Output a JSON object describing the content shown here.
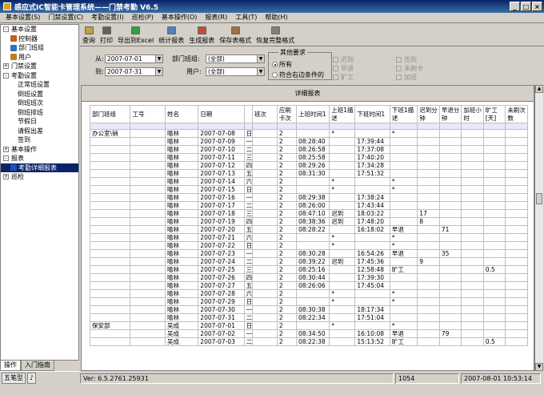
{
  "window": {
    "title": "感应式IC智能卡管理系统——门禁考勤 V6.5"
  },
  "menu": [
    "基本设置(S)",
    "门禁设置(C)",
    "考勤设置(I)",
    "巡检(P)",
    "基本操作(O)",
    "报表(R)",
    "工具(T)",
    "帮助(H)"
  ],
  "tree": [
    {
      "label": "基本设置",
      "level": 0,
      "exp": "-"
    },
    {
      "label": "控制器",
      "level": 1,
      "icon": "#c06020"
    },
    {
      "label": "部门班组",
      "level": 1,
      "icon": "#3070c0"
    },
    {
      "label": "用户",
      "level": 1,
      "icon": "#c08020"
    },
    {
      "label": "门禁设置",
      "level": 0,
      "exp": "+"
    },
    {
      "label": "考勤设置",
      "level": 0,
      "exp": "-"
    },
    {
      "label": "正常班设置",
      "level": 2
    },
    {
      "label": "倒班设置",
      "level": 2
    },
    {
      "label": "倒班班次",
      "level": 2
    },
    {
      "label": "倒班排班",
      "level": 2
    },
    {
      "label": "节假日",
      "level": 2
    },
    {
      "label": "请假出差",
      "level": 2
    },
    {
      "label": "签到",
      "level": 2
    },
    {
      "label": "基本操作",
      "level": 0,
      "exp": "+"
    },
    {
      "label": "报表",
      "level": 0,
      "exp": "-"
    },
    {
      "label": "考勤详细报表",
      "level": 1,
      "icon": "#2050b0",
      "sel": true
    },
    {
      "label": "巡检",
      "level": 0,
      "exp": "+"
    }
  ],
  "left_tabs": [
    "操作",
    "入门指南"
  ],
  "taskbar": [
    "五笔型",
    "♪"
  ],
  "toolbar": [
    "查询",
    "打印",
    "导出到Excel",
    "统计报表",
    "生成报表",
    "保存表格式",
    "恢复完整格式"
  ],
  "filters": {
    "from_label": "从:",
    "from_value": "2007-07-01",
    "to_label": "到:",
    "to_value": "2007-07-31",
    "dept_label": "部门班组:",
    "dept_value": "(全部)",
    "user_label": "用户:",
    "user_value": "(全部)",
    "req_title": "其他要求",
    "req_all": "所有",
    "req_match": "符合右边条件的",
    "checks": [
      "迟到",
      "早退",
      "旷工",
      "签到",
      "未刷卡",
      "加班"
    ]
  },
  "report": {
    "title": "详细报表",
    "headers": [
      "部门班组",
      "工号",
      "姓名",
      "日期",
      "",
      "班次",
      "应刷卡次",
      "上班时间1",
      "上班1描述",
      "下班时间1",
      "下班1描述",
      "迟到分钟",
      "早退分钟",
      "加班小时",
      "旷工[天]",
      "未刷次数"
    ],
    "rows": [
      [
        "办公室\\销",
        "",
        "喻林",
        "2007-07-08",
        "日",
        "",
        "2",
        "",
        "*",
        "",
        "*",
        "",
        "",
        "",
        "",
        ""
      ],
      [
        "",
        "",
        "喻林",
        "2007-07-09",
        "一",
        "",
        "2",
        "08:28:40",
        "",
        "17:39:44",
        "",
        "",
        "",
        "",
        "",
        ""
      ],
      [
        "",
        "",
        "喻林",
        "2007-07-10",
        "二",
        "",
        "2",
        "08:26:58",
        "",
        "17:37:08",
        "",
        "",
        "",
        "",
        "",
        ""
      ],
      [
        "",
        "",
        "喻林",
        "2007-07-11",
        "三",
        "",
        "2",
        "08:25:58",
        "",
        "17:40:20",
        "",
        "",
        "",
        "",
        "",
        ""
      ],
      [
        "",
        "",
        "喻林",
        "2007-07-12",
        "四",
        "",
        "2",
        "08:29:26",
        "",
        "17:34:28",
        "",
        "",
        "",
        "",
        "",
        ""
      ],
      [
        "",
        "",
        "喻林",
        "2007-07-13",
        "五",
        "",
        "2",
        "08:31:30",
        "",
        "17:51:32",
        "",
        "",
        "",
        "",
        "",
        ""
      ],
      [
        "",
        "",
        "喻林",
        "2007-07-14",
        "六",
        "",
        "2",
        "",
        "*",
        "",
        "*",
        "",
        "",
        "",
        "",
        ""
      ],
      [
        "",
        "",
        "喻林",
        "2007-07-15",
        "日",
        "",
        "2",
        "",
        "*",
        "",
        "*",
        "",
        "",
        "",
        "",
        ""
      ],
      [
        "",
        "",
        "喻林",
        "2007-07-16",
        "一",
        "",
        "2",
        "08:29:38",
        "",
        "17:38:24",
        "",
        "",
        "",
        "",
        "",
        ""
      ],
      [
        "",
        "",
        "喻林",
        "2007-07-17",
        "二",
        "",
        "2",
        "08:26:00",
        "",
        "17:43:44",
        "",
        "",
        "",
        "",
        "",
        ""
      ],
      [
        "",
        "",
        "喻林",
        "2007-07-18",
        "三",
        "",
        "2",
        "08:47:10",
        "迟到",
        "18:03:22",
        "",
        "17",
        "",
        "",
        "",
        ""
      ],
      [
        "",
        "",
        "喻林",
        "2007-07-19",
        "四",
        "",
        "2",
        "08:38:36",
        "迟到",
        "17:48:20",
        "",
        "8",
        "",
        "",
        "",
        ""
      ],
      [
        "",
        "",
        "喻林",
        "2007-07-20",
        "五",
        "",
        "2",
        "08:28:22",
        "",
        "16:18:02",
        "早退",
        "",
        "71",
        "",
        "",
        ""
      ],
      [
        "",
        "",
        "喻林",
        "2007-07-21",
        "六",
        "",
        "2",
        "",
        "*",
        "",
        "*",
        "",
        "",
        "",
        "",
        ""
      ],
      [
        "",
        "",
        "喻林",
        "2007-07-22",
        "日",
        "",
        "2",
        "",
        "*",
        "",
        "*",
        "",
        "",
        "",
        "",
        ""
      ],
      [
        "",
        "",
        "喻林",
        "2007-07-23",
        "一",
        "",
        "2",
        "08:30:28",
        "",
        "16:54:26",
        "早退",
        "",
        "35",
        "",
        "",
        ""
      ],
      [
        "",
        "",
        "喻林",
        "2007-07-24",
        "二",
        "",
        "2",
        "08:39:22",
        "迟到",
        "17:45:36",
        "",
        "9",
        "",
        "",
        "",
        ""
      ],
      [
        "",
        "",
        "喻林",
        "2007-07-25",
        "三",
        "",
        "2",
        "08:25:16",
        "",
        "12:58:48",
        "旷工",
        "",
        "",
        "",
        "0.5",
        ""
      ],
      [
        "",
        "",
        "喻林",
        "2007-07-26",
        "四",
        "",
        "2",
        "08:30:44",
        "",
        "17:39:30",
        "",
        "",
        "",
        "",
        "",
        ""
      ],
      [
        "",
        "",
        "喻林",
        "2007-07-27",
        "五",
        "",
        "2",
        "08:26:06",
        "",
        "17:45:04",
        "",
        "",
        "",
        "",
        "",
        ""
      ],
      [
        "",
        "",
        "喻林",
        "2007-07-28",
        "六",
        "",
        "2",
        "",
        "*",
        "",
        "*",
        "",
        "",
        "",
        "",
        ""
      ],
      [
        "",
        "",
        "喻林",
        "2007-07-29",
        "日",
        "",
        "2",
        "",
        "*",
        "",
        "*",
        "",
        "",
        "",
        "",
        ""
      ],
      [
        "",
        "",
        "喻林",
        "2007-07-30",
        "一",
        "",
        "2",
        "08:30:38",
        "",
        "18:17:34",
        "",
        "",
        "",
        "",
        "",
        ""
      ],
      [
        "",
        "",
        "喻林",
        "2007-07-31",
        "二",
        "",
        "2",
        "08:22:34",
        "",
        "17:51:04",
        "",
        "",
        "",
        "",
        "",
        ""
      ],
      [
        "保安部",
        "",
        "吴成",
        "2007-07-01",
        "日",
        "",
        "2",
        "",
        "*",
        "",
        "*",
        "",
        "",
        "",
        "",
        ""
      ],
      [
        "",
        "",
        "吴成",
        "2007-07-02",
        "一",
        "",
        "2",
        "08:34:50",
        "",
        "16:10:08",
        "早退",
        "",
        "79",
        "",
        "",
        ""
      ],
      [
        "",
        "",
        "吴成",
        "2007-07-03",
        "二",
        "",
        "2",
        "08:22:38",
        "",
        "15:13:52",
        "旷工",
        "",
        "",
        "",
        "0.5",
        ""
      ]
    ]
  },
  "status": {
    "version": "Ver: 6.5.2761.25931",
    "count": "1054",
    "datetime": "2007-08-01 10:53:14"
  }
}
